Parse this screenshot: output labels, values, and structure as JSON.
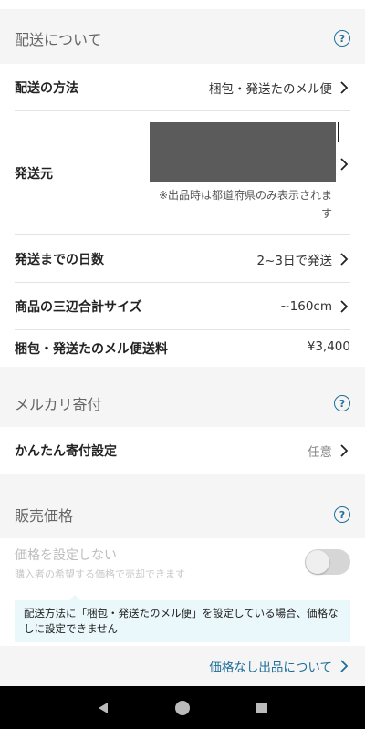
{
  "shipping_section": {
    "title": "配送について"
  },
  "shipping_method": {
    "label": "配送の方法",
    "value": "梱包・発送たのメル便"
  },
  "origin": {
    "label": "発送元",
    "note": "※出品時は都道府県のみ表示されます"
  },
  "days": {
    "label": "発送までの日数",
    "value": "2~3日で発送"
  },
  "size": {
    "label": "商品の三辺合計サイズ",
    "value": "~160cm"
  },
  "fee": {
    "label": "梱包・発送たのメル便送料",
    "value": "¥3,400"
  },
  "donation_section": {
    "title": "メルカリ寄付"
  },
  "donation": {
    "label": "かんたん寄付設定",
    "value": "任意"
  },
  "price_section": {
    "title": "販売価格"
  },
  "no_price": {
    "title": "価格を設定しない",
    "subtitle": "購入者の希望する価格で売却できます",
    "enabled": false
  },
  "notice": {
    "text": "配送方法に「梱包・発送たのメル便」を設定している場合、価格なしに設定できません"
  },
  "link": {
    "label": "価格なし出品について"
  },
  "colors": {
    "accent": "#1f6f9a",
    "notice_bg": "#eaf7fb",
    "navbar": "#000000"
  },
  "icons": [
    "help-circle-icon",
    "chevron-right-icon",
    "back-triangle-icon",
    "home-circle-icon",
    "recents-square-icon"
  ]
}
